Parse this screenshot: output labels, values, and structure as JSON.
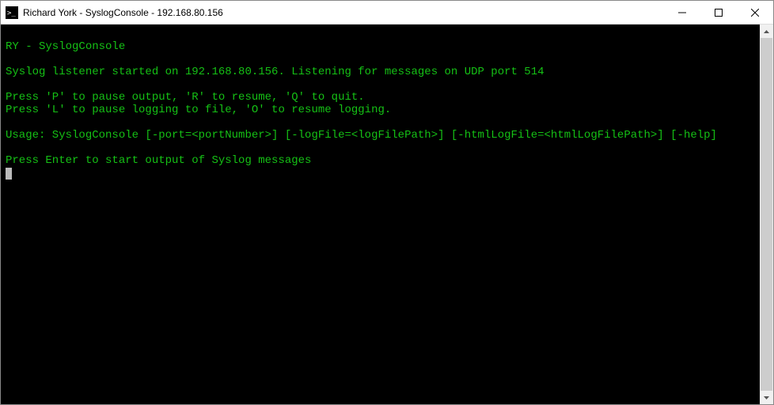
{
  "titlebar": {
    "title": "Richard York - SyslogConsole - 192.168.80.156"
  },
  "console": {
    "lines": [
      "",
      "RY - SyslogConsole",
      "",
      "Syslog listener started on 192.168.80.156. Listening for messages on UDP port 514",
      "",
      "Press 'P' to pause output, 'R' to resume, 'Q' to quit.",
      "Press 'L' to pause logging to file, 'O' to resume logging.",
      "",
      "Usage: SyslogConsole [-port=<portNumber>] [-logFile=<logFilePath>] [-htmlLogFile=<htmlLogFilePath>] [-help]",
      "",
      "Press Enter to start output of Syslog messages"
    ]
  }
}
